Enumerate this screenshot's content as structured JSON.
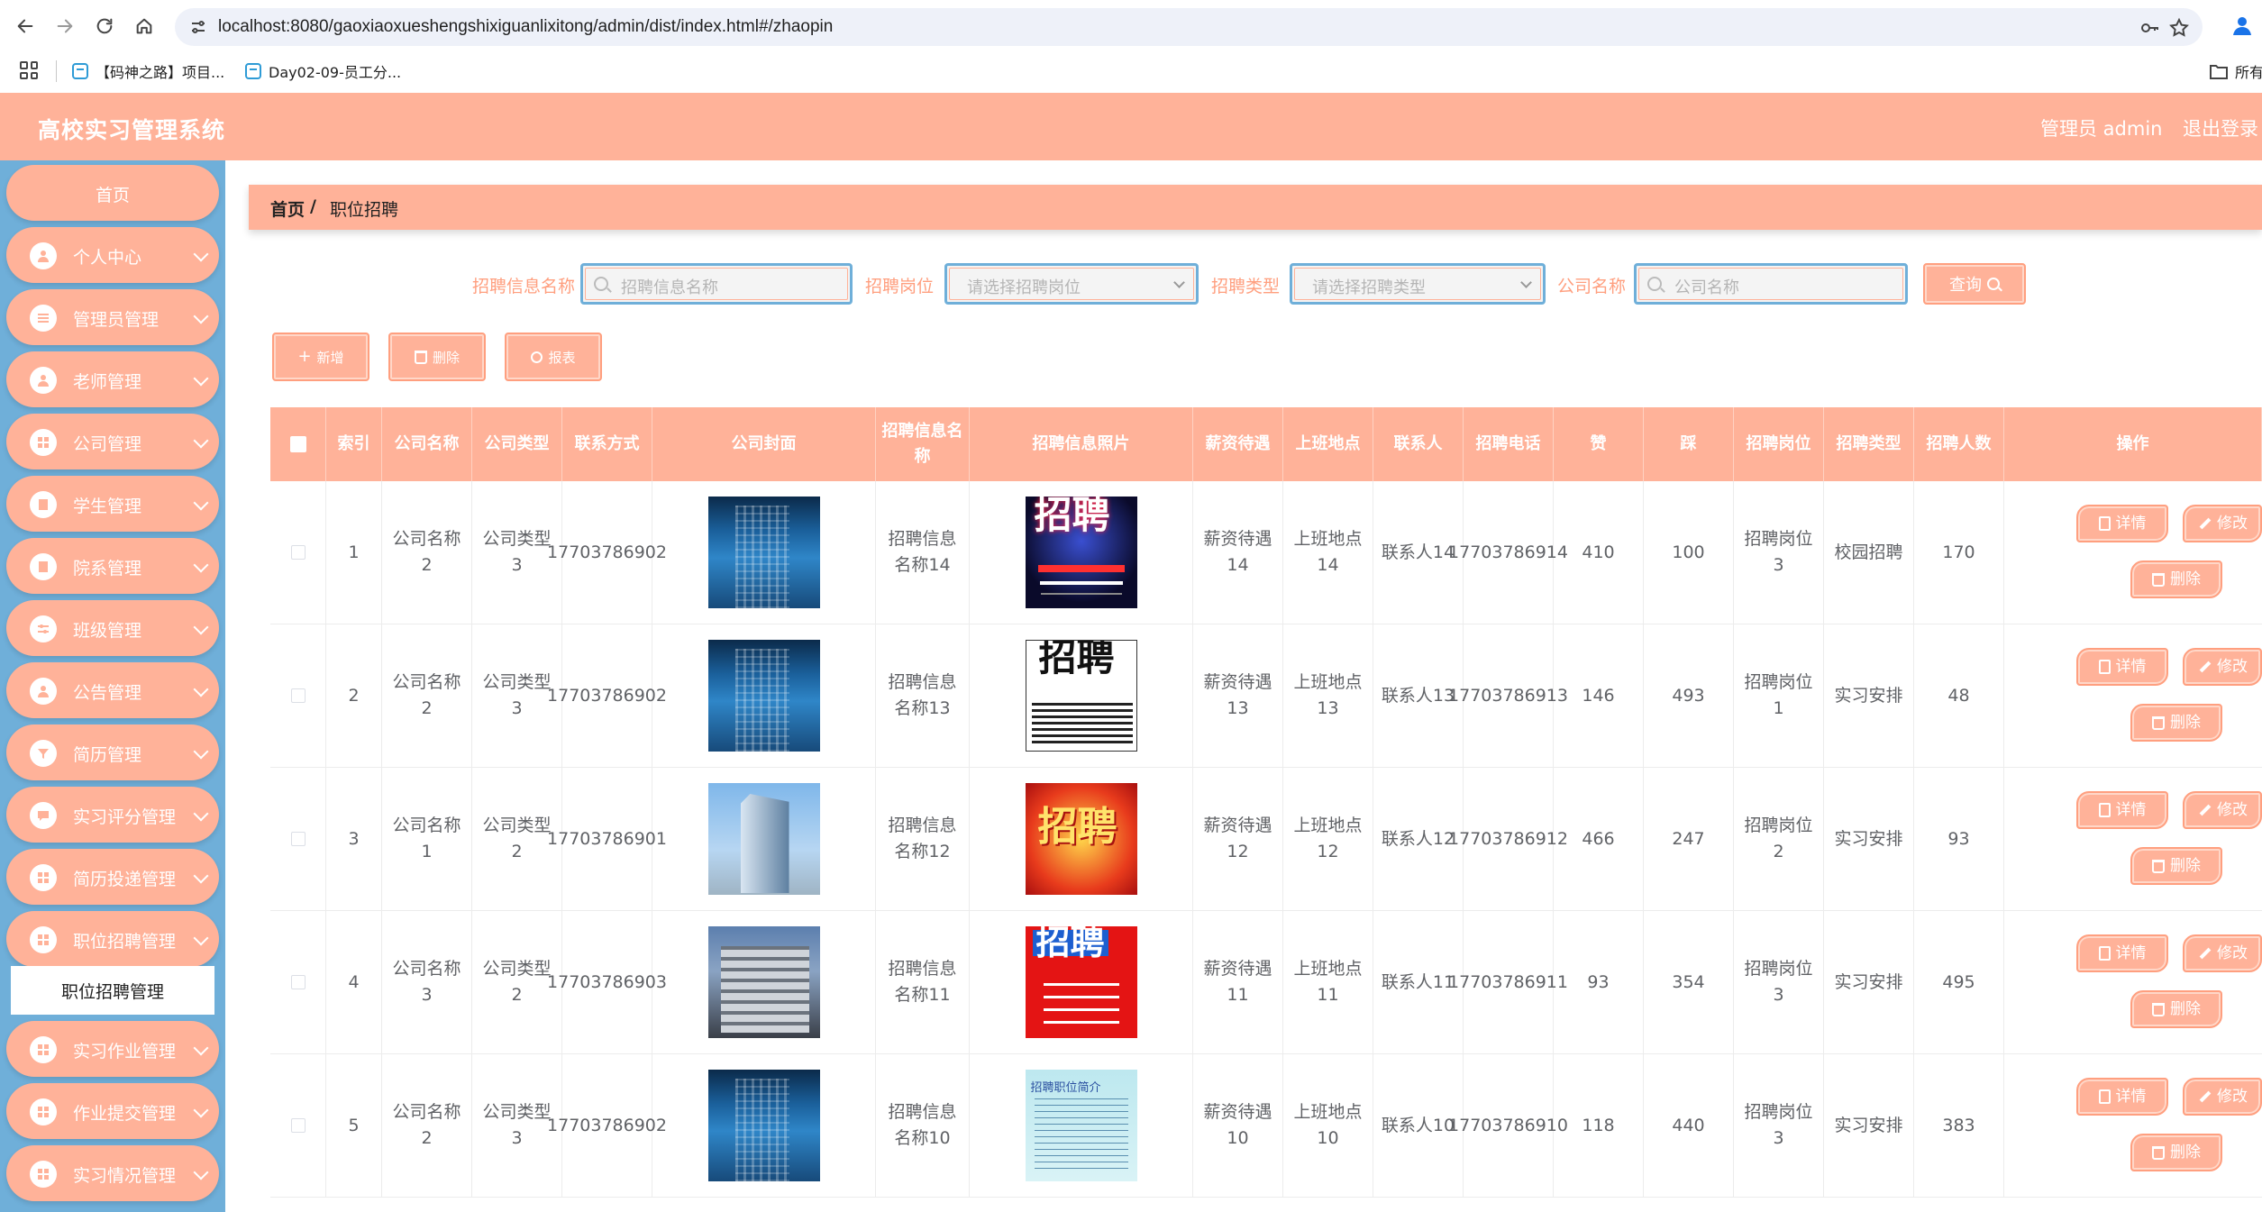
{
  "browser": {
    "url": "localhost:8080/gaoxiaoxueshengshixiguanlixitong/admin/dist/index.html#/zhaopin",
    "bookmarks": [
      "【码神之路】项目...",
      "Day02-09-员工分..."
    ],
    "bookmarks_right": "所有"
  },
  "header": {
    "title": "高校实习管理系统",
    "user": "管理员 admin",
    "logout": "退出登录"
  },
  "sidebar": {
    "home": "首页",
    "items": [
      {
        "label": "个人中心",
        "icon": "user-icon"
      },
      {
        "label": "管理员管理",
        "icon": "list-icon"
      },
      {
        "label": "老师管理",
        "icon": "user-icon"
      },
      {
        "label": "公司管理",
        "icon": "grid-icon"
      },
      {
        "label": "学生管理",
        "icon": "doc-icon"
      },
      {
        "label": "院系管理",
        "icon": "doc-icon"
      },
      {
        "label": "班级管理",
        "icon": "sliders-icon"
      },
      {
        "label": "公告管理",
        "icon": "user-icon"
      },
      {
        "label": "简历管理",
        "icon": "filter-icon"
      },
      {
        "label": "实习评分管理",
        "icon": "chat-icon"
      },
      {
        "label": "简历投递管理",
        "icon": "grid-icon"
      },
      {
        "label": "职位招聘管理",
        "icon": "grid-icon"
      },
      {
        "label": "实习作业管理",
        "icon": "grid-icon"
      },
      {
        "label": "作业提交管理",
        "icon": "grid-icon"
      },
      {
        "label": "实习情况管理",
        "icon": "grid-icon"
      }
    ],
    "active_submenu": "职位招聘管理"
  },
  "breadcrumb": {
    "home": "首页",
    "sep": "/",
    "current": "职位招聘"
  },
  "search": {
    "name_label": "招聘信息名称",
    "name_placeholder": "招聘信息名称",
    "position_label": "招聘岗位",
    "position_placeholder": "请选择招聘岗位",
    "type_label": "招聘类型",
    "type_placeholder": "请选择招聘类型",
    "company_label": "公司名称",
    "company_placeholder": "公司名称",
    "query_label": "查询"
  },
  "actions": {
    "add": "新增",
    "delete": "删除",
    "report": "报表"
  },
  "table": {
    "columns": [
      "索引",
      "公司名称",
      "公司类型",
      "联系方式",
      "公司封面",
      "招聘信息名称",
      "招聘信息照片",
      "薪资待遇",
      "上班地点",
      "联系人",
      "招聘电话",
      "赞",
      "踩",
      "招聘岗位",
      "招聘类型",
      "招聘人数",
      "操作"
    ],
    "row_buttons": {
      "detail": "详情",
      "edit": "修改",
      "delete": "删除"
    },
    "rows": [
      {
        "index": "1",
        "company": "公司名称2",
        "ctype": "公司类型3",
        "phone": "17703786902",
        "name": "招聘信息名称14",
        "salary": "薪资待遇14",
        "place": "上班地点14",
        "contact": "联系人14",
        "tel": "17703786914",
        "zan": "410",
        "cai": "100",
        "position": "招聘岗位3",
        "rtype": "校园招聘",
        "count": "170"
      },
      {
        "index": "2",
        "company": "公司名称2",
        "ctype": "公司类型3",
        "phone": "17703786902",
        "name": "招聘信息名称13",
        "salary": "薪资待遇13",
        "place": "上班地点13",
        "contact": "联系人13",
        "tel": "17703786913",
        "zan": "146",
        "cai": "493",
        "position": "招聘岗位1",
        "rtype": "实习安排",
        "count": "48"
      },
      {
        "index": "3",
        "company": "公司名称1",
        "ctype": "公司类型2",
        "phone": "17703786901",
        "name": "招聘信息名称12",
        "salary": "薪资待遇12",
        "place": "上班地点12",
        "contact": "联系人12",
        "tel": "17703786912",
        "zan": "466",
        "cai": "247",
        "position": "招聘岗位2",
        "rtype": "实习安排",
        "count": "93"
      },
      {
        "index": "4",
        "company": "公司名称3",
        "ctype": "公司类型2",
        "phone": "17703786903",
        "name": "招聘信息名称11",
        "salary": "薪资待遇11",
        "place": "上班地点11",
        "contact": "联系人11",
        "tel": "17703786911",
        "zan": "93",
        "cai": "354",
        "position": "招聘岗位3",
        "rtype": "实习安排",
        "count": "495"
      },
      {
        "index": "5",
        "company": "公司名称2",
        "ctype": "公司类型3",
        "phone": "17703786902",
        "name": "招聘信息名称10",
        "salary": "薪资待遇10",
        "place": "上班地点10",
        "contact": "联系人10",
        "tel": "17703786910",
        "zan": "118",
        "cai": "440",
        "position": "招聘岗位3",
        "rtype": "实习安排",
        "count": "383"
      }
    ]
  },
  "colors": {
    "accent": "#ffb299",
    "sidebar": "#6fafd9",
    "label": "#ff9f7f"
  }
}
